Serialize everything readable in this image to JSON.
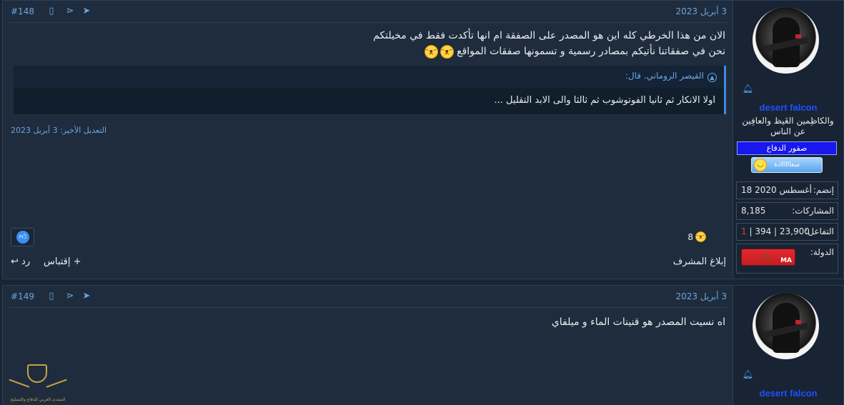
{
  "post1": {
    "date": "3 أبريل 2023",
    "number": "#148",
    "body_line1": "الان من هذا الخرطي كله اين هو المصدر على الصفقة ام انها تأكدت فقط في مخيلتكم",
    "body_line2": "نحن في صفقاتنا نأتيكم بمصادر رسمية و تسمونها صفقات المواقع",
    "quote_author": "القيصر الروماني. قال:",
    "quote_body": "اولا الانكار ثم ثانيا الفوتوشوب ثم ثالثا والى الابد التقليل ...",
    "edited": "التعديل الأخير: 3 أبريل 2023",
    "reaction_count": "8",
    "report_label": "إبلاغ المشرف",
    "quote_label": "+ إقتباس",
    "reply_label": "رد"
  },
  "user1": {
    "name": "desert falcon",
    "title": "والكاظِمين الغَيظ والعافِين عن الناس",
    "banner": "صقور الدفاع",
    "badge": "سعاااااادة",
    "joined_label": "إنضم:",
    "joined_value": "18 أغسطس 2020",
    "posts_label": "المشاركات:",
    "posts_value": "8,185",
    "reactions_label": "التفاعل:",
    "reactions_value_a": "23,900",
    "reactions_value_b": "394",
    "reactions_value_c": "1",
    "country_label": "الدولة:",
    "flag_code": "MA"
  },
  "post2": {
    "date": "3 أبريل 2023",
    "number": "#149",
    "body_line1": "اه نسيت المصدر هو قنينات الماء و ميلفاي"
  },
  "user2": {
    "name": "desert falcon"
  },
  "watermark": {
    "text": "المنتدى العربي للدفاع والتسليح"
  },
  "colors": {
    "accent": "#6aa6e0",
    "username": "#1f50ff",
    "bg": "#1f2c3d"
  }
}
